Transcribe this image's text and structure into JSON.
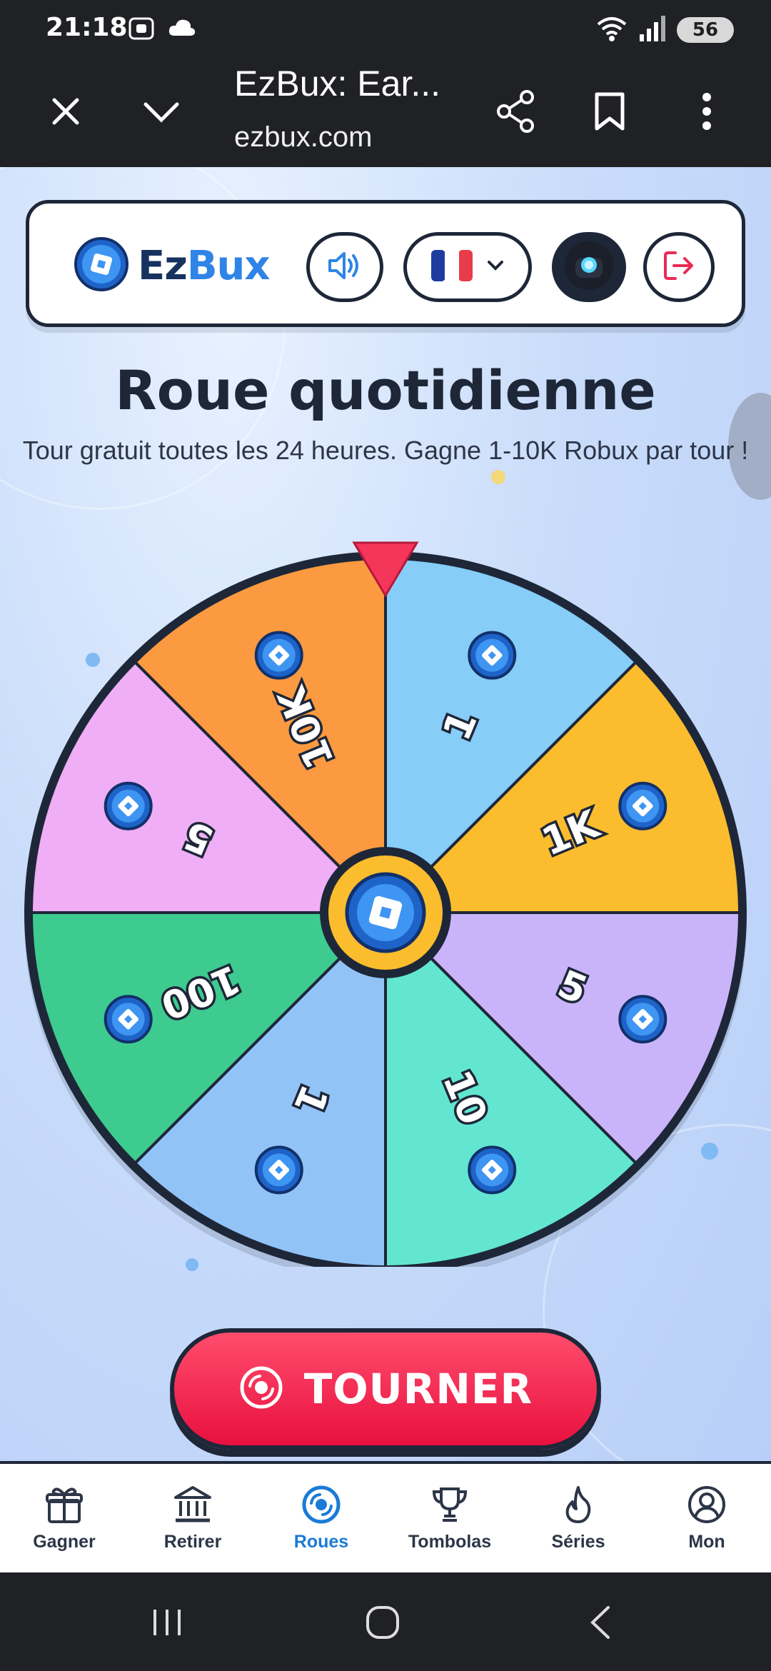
{
  "status_bar": {
    "time": "21:18",
    "battery": "56"
  },
  "browser": {
    "title": "EzBux: Ear...",
    "url": "ezbux.com"
  },
  "header": {
    "logo_ez": "Ez",
    "logo_bux": "Bux"
  },
  "main": {
    "title": "Roue quotidienne",
    "subtitle": "Tour gratuit toutes les 24 heures. Gagne 1-10K Robux par tour !",
    "spin_label": "TOURNER"
  },
  "wheel": {
    "segments": [
      {
        "label": "1",
        "color": "#86cdf8"
      },
      {
        "label": "1K",
        "color": "#fbbc2e"
      },
      {
        "label": "5",
        "color": "#c9b4fa"
      },
      {
        "label": "10",
        "color": "#62e6d2"
      },
      {
        "label": "1",
        "color": "#92c3f7"
      },
      {
        "label": "100",
        "color": "#3ecb8f"
      },
      {
        "label": "5",
        "color": "#efaef5"
      },
      {
        "label": "10K",
        "color": "#fb9a40"
      }
    ],
    "pointer_color": "#f4365a",
    "rim_color": "#1e2738"
  },
  "bottom_nav": [
    {
      "label": "Gagner",
      "icon": "gift-icon",
      "active": false
    },
    {
      "label": "Retirer",
      "icon": "bank-icon",
      "active": false
    },
    {
      "label": "Roues",
      "icon": "wheel-icon",
      "active": true
    },
    {
      "label": "Tombolas",
      "icon": "trophy-icon",
      "active": false
    },
    {
      "label": "Séries",
      "icon": "flame-icon",
      "active": false
    },
    {
      "label": "Mon",
      "icon": "user-icon",
      "active": false
    }
  ],
  "colors": {
    "accent": "#1a7bd6",
    "spin_button": "#f01e4a",
    "dark": "#1e2738"
  }
}
